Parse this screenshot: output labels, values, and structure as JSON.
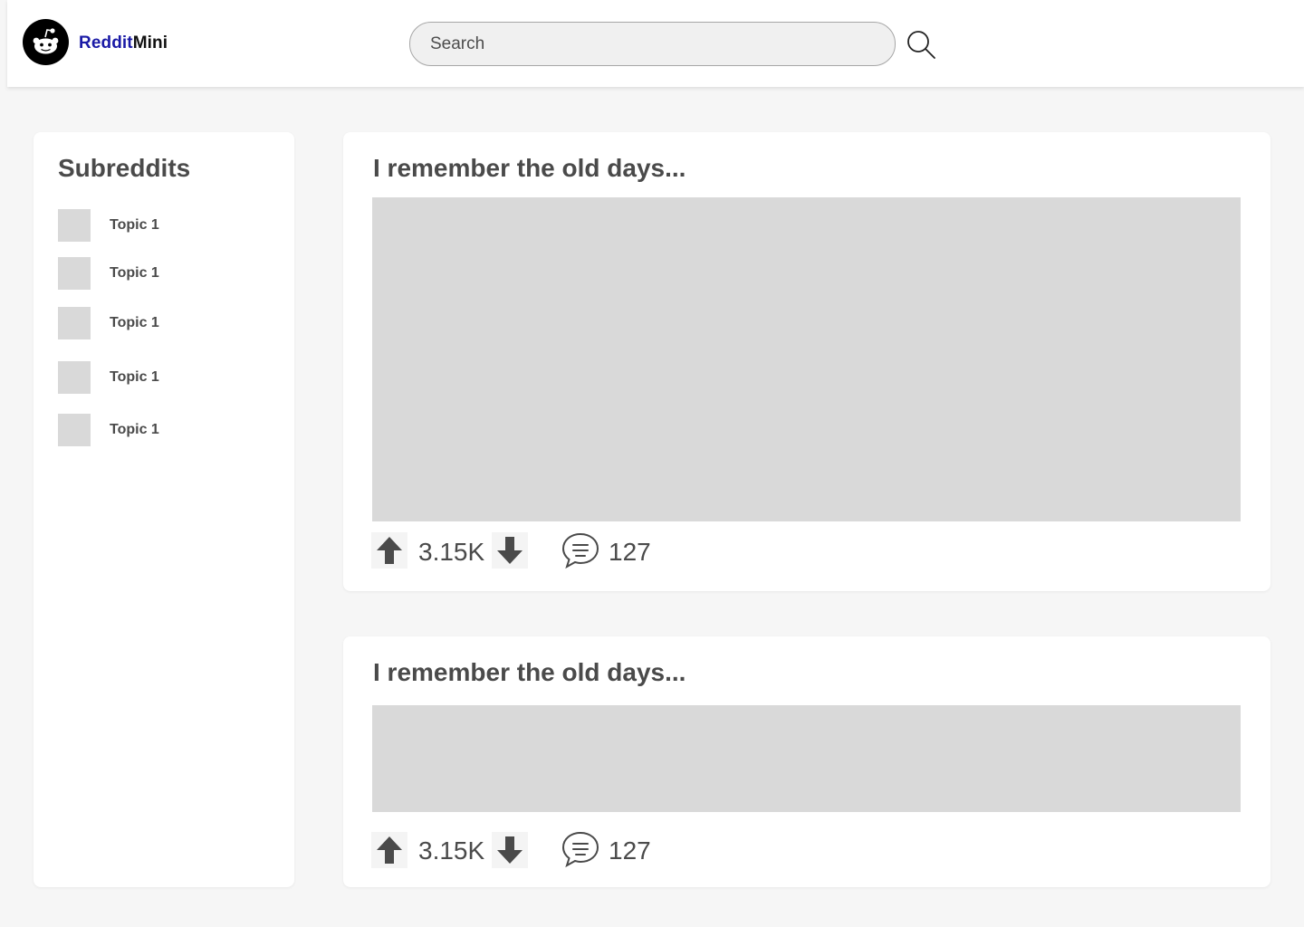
{
  "header": {
    "brand_part1": "Reddit",
    "brand_part2": "Mini",
    "search_placeholder": "Search",
    "brand_color": "#1a1aa6"
  },
  "sidebar": {
    "title": "Subreddits",
    "topics": [
      {
        "label": "Topic 1"
      },
      {
        "label": "Topic 1"
      },
      {
        "label": "Topic 1"
      },
      {
        "label": "Topic 1"
      },
      {
        "label": "Topic 1"
      }
    ]
  },
  "posts": [
    {
      "title": "I remember the old days...",
      "score": "3.15K",
      "comments": "127"
    },
    {
      "title": "I remember the old days...",
      "score": "3.15K",
      "comments": "127"
    }
  ],
  "icons": {
    "logo": "reddit-alien-icon",
    "search": "magnifier-icon",
    "upvote": "arrow-up-icon",
    "downvote": "arrow-down-icon",
    "comments": "speech-bubble-icon"
  }
}
